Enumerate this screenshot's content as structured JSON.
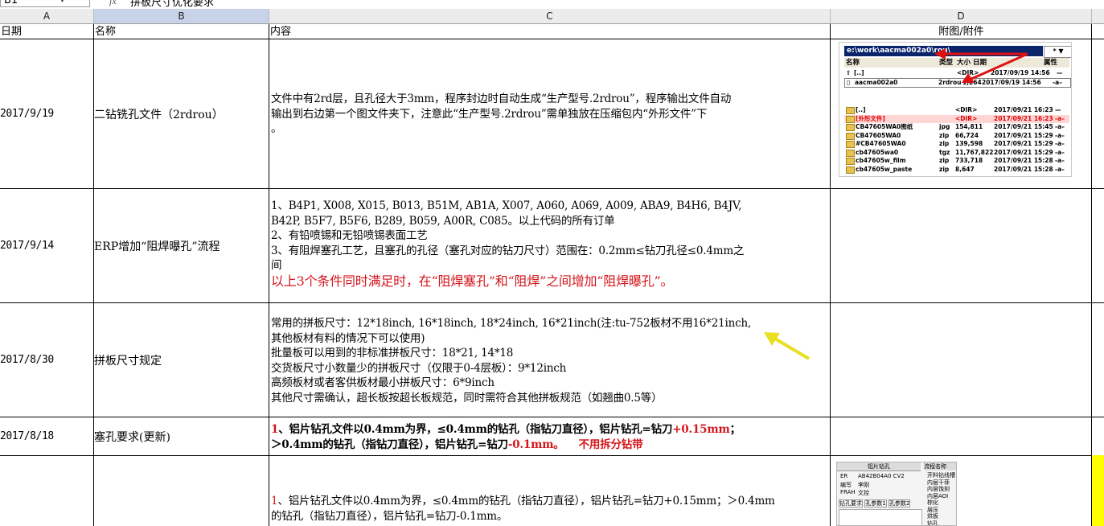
{
  "formula_bar": {
    "name_box": "B1",
    "fx_label": "fx",
    "formula": "拼板尺寸优化要求"
  },
  "columns": [
    "A",
    "B",
    "C",
    "D"
  ],
  "header_row": {
    "date": "日期",
    "name": "名称",
    "content": "内容",
    "attachment": "附图/附件"
  },
  "rows": [
    {
      "date": "2017/9/19",
      "name": "二钻铣孔文件（2rdrou）",
      "content": [
        "文件中有2rd层，且孔径大于3mm，程序封边时自动生成“生产型号.2rdrou”，程序输出文件自动",
        "输出到右边第一个图文件夹下，注意此“生产型号.2rdrou”需单独放在压缩包内“外形文件”下",
        "。"
      ]
    },
    {
      "date": "2017/9/14",
      "name": "ERP增加“阻焊曝孔”流程",
      "content": [
        "1、B4P1, X008, X015, B013, B51M, AB1A, X007, A060, A069, A009, ABA9, B4H6, B4JV,",
        "B42P, B5F7, B5F6, B289, B059, A00R, C085。以上代码的所有订单",
        "2、有铅喷锡和无铅喷锡表面工艺",
        "3、有阻焊塞孔工艺，且塞孔的孔径（塞孔对应的钻刀尺寸）范围在：0.2mm≤钻刀孔径≤0.4mm之",
        "间"
      ],
      "highlight": "以上3个条件同时满足时，在“阻焊塞孔”和“阻焊”之间增加“阻焊曝孔”。"
    },
    {
      "date": "2017/8/30",
      "name": "拼板尺寸规定",
      "content": [
        "常用的拼板尺寸：12*18inch, 16*18inch, 18*24inch, 16*21inch(注:tu-752板材不用16*21inch,",
        "其他板材有料的情况下可以使用)",
        "批量板可以用到的非标准拼板尺寸：18*21, 14*18",
        "交货板尺寸小数量少的拼板尺寸（仅限于0-4层板）：9*12inch",
        "高频板材或者客供板材最小拼板尺寸：6*9inch",
        "其他尺寸需确认，超长板按超长板规范，同时需符合其他拼板规范（如翘曲0.5等）"
      ]
    },
    {
      "date": "2017/8/18",
      "name": "塞孔要求(更新)",
      "line1": {
        "num": "1",
        "a": "、铝片钻孔文件以0.4mm为界，≤0.4mm的钻孔（指钻刀直径），铝片钻孔=钻刀",
        "b": "+0.15mm",
        "c": "；"
      },
      "line2": {
        "a": "＞0.4mm的钻孔（指钻刀直径），铝片钻孔=钻刀",
        "b": "-0.1mm。",
        "gap": "    ",
        "c": "不用拆分钻带"
      }
    },
    {
      "date": "",
      "name": "",
      "num": "1",
      "content": [
        "、铝片钻孔文件以0.4mm为界，≤0.4mm的钻孔（指钻刀直径），铝片钻孔=钻刀+0.15mm；＞0.4mm",
        "的钻孔（指钻刀直径），铝片钻孔=钻刀-0.1mm。"
      ]
    }
  ],
  "attachment1": {
    "path": "e:\\work\\aacma002a0\\rou\\",
    "buttons": "* ▼",
    "headers": [
      "名称",
      "类型",
      "大小",
      "日期",
      "属性"
    ],
    "top_rows": [
      {
        "name": "[..]",
        "type": "",
        "size": "<DIR>",
        "date": "2017/09/19 14:56",
        "attr": "—"
      },
      {
        "name": "aacma002a0",
        "type": "2rdrou",
        "size": "1,264",
        "date": "2017/09/19 14:56",
        "attr": "-a–"
      }
    ],
    "bottom_rows": [
      {
        "name": "[..]",
        "type": "",
        "size": "<DIR>",
        "date": "2017/09/21 16:23",
        "attr": "—"
      },
      {
        "name": "[外形文件]",
        "type": "",
        "size": "<DIR>",
        "date": "2017/09/21 16:23",
        "attr": "-a–"
      },
      {
        "name": "CB47605WA0图纸",
        "type": "jpg",
        "size": "154,811",
        "date": "2017/09/21 15:45",
        "attr": "-a–"
      },
      {
        "name": "CB47605WA0",
        "type": "zip",
        "size": "66,724",
        "date": "2017/09/21 15:29",
        "attr": "-a–"
      },
      {
        "name": "#CB47605WA0",
        "type": "zip",
        "size": "139,598",
        "date": "2017/09/21 15:29",
        "attr": "-a–"
      },
      {
        "name": "cb47605wa0",
        "type": "tgz",
        "size": "11,767,822",
        "date": "2017/09/21 15:29",
        "attr": "-a–"
      },
      {
        "name": "cb47605w_film",
        "type": "zip",
        "size": "733,718",
        "date": "2017/09/21 15:28",
        "attr": "-a–"
      },
      {
        "name": "cb47605w_paste",
        "type": "zip",
        "size": "8,647",
        "date": "2017/09/21 15:28",
        "attr": "-a–"
      }
    ]
  },
  "attachment2": {
    "title": "铝片钻孔",
    "side_title": "流程名称",
    "rows": [
      [
        "ER",
        "AB42B04A0 CV2"
      ],
      [
        "编写",
        "李刚"
      ],
      [
        "FRAH",
        "文控"
      ]
    ],
    "side_items": [
      "开料钻线槽",
      "内层干菲",
      "内层蚀刻",
      "内层AOI",
      "棕化",
      "层压",
      "烘板",
      "钻孔"
    ],
    "tabs": [
      "钻孔要求",
      "孔参数1",
      "孔参数2"
    ]
  },
  "colors": {
    "selected_header": "#c7d3e8",
    "highlight_red": "#d4161c",
    "fill_yellow": "#ffff00",
    "annotation_arrow": "#e8e020"
  }
}
